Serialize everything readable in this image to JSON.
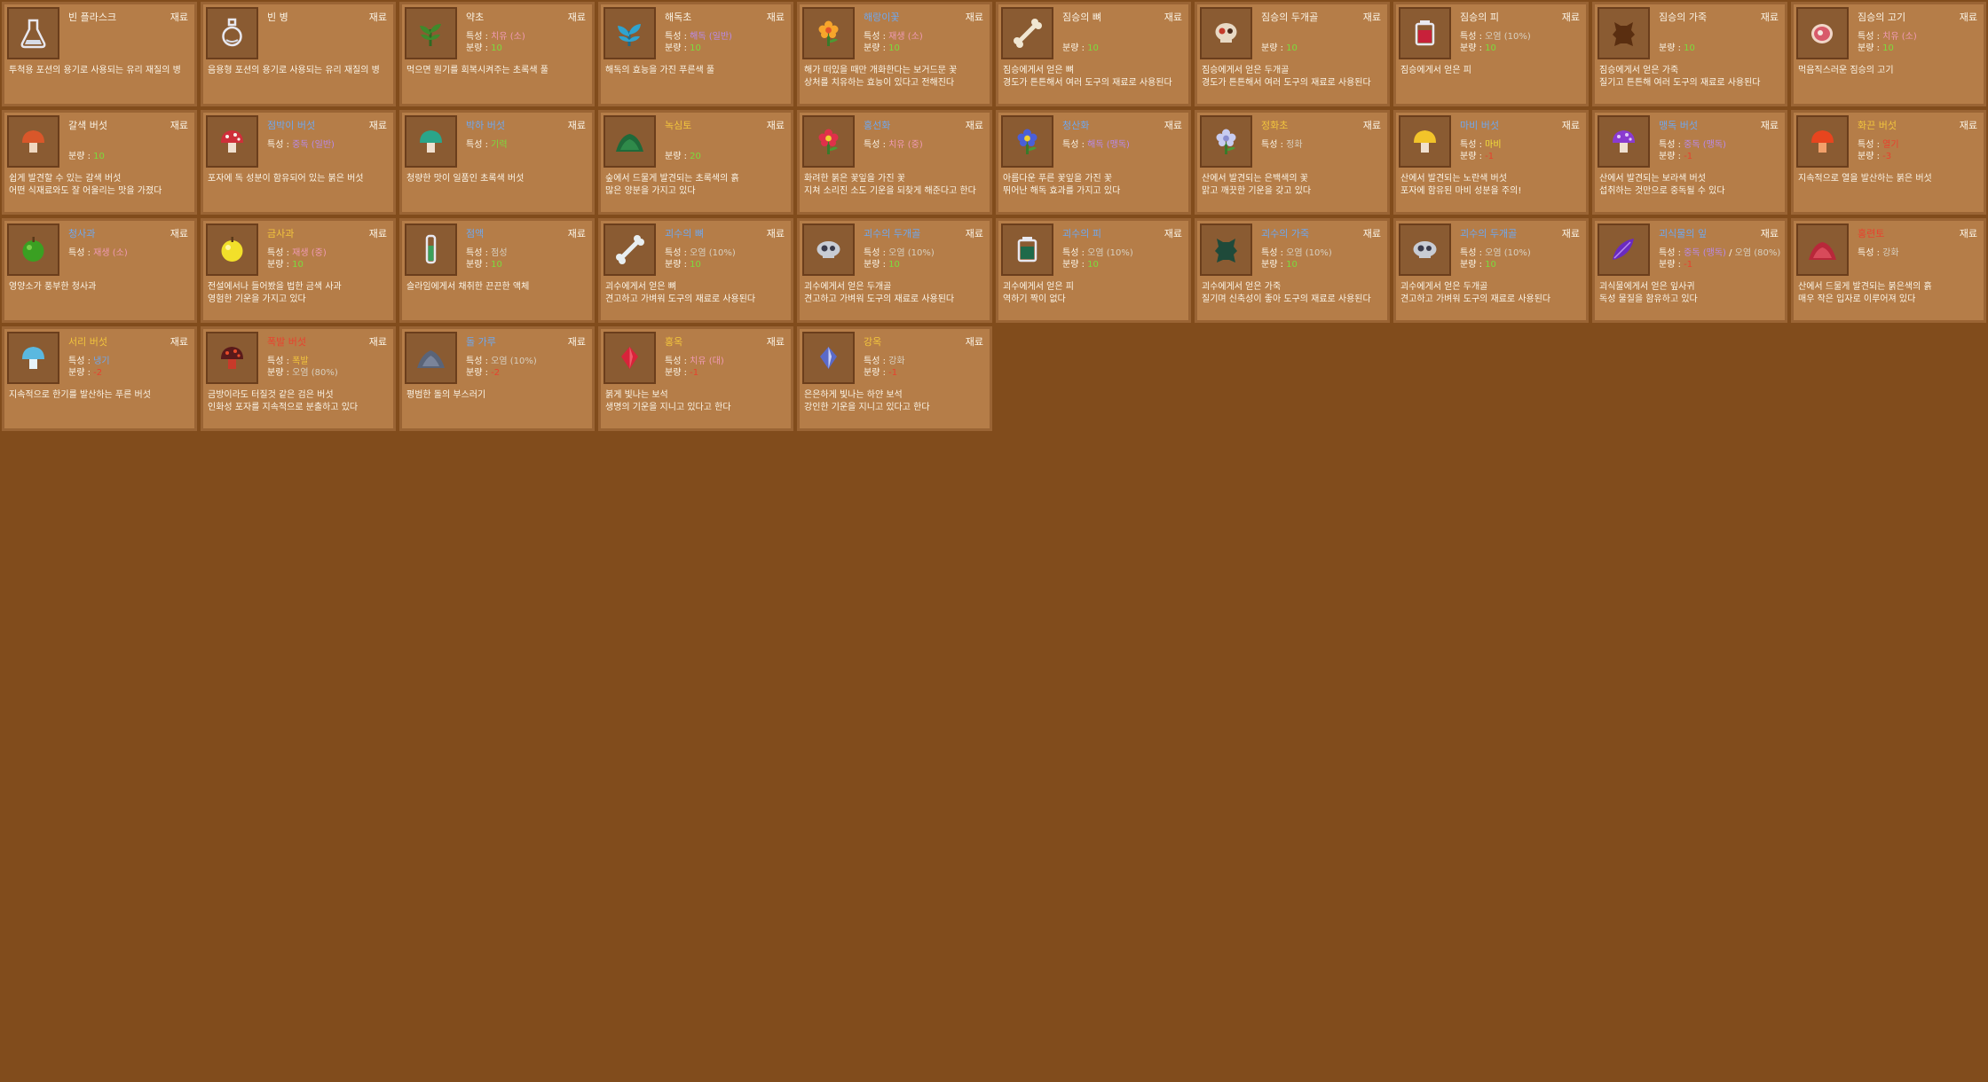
{
  "items": [
    {
      "name": "빈 플라스크",
      "name_color": "white",
      "tag": "재료",
      "icon": "flask-icon",
      "stats": [],
      "desc": "투척용 포션의 용기로 사용되는 유리 재질의 병"
    },
    {
      "name": "빈 병",
      "name_color": "white",
      "tag": "재료",
      "icon": "bottle-icon",
      "stats": [],
      "desc": "음용형 포션의 용기로 사용되는 유리 재질의 병"
    },
    {
      "name": "약초",
      "name_color": "white",
      "tag": "재료",
      "icon": "herb-icon",
      "stats": [
        {
          "label": "특성 : ",
          "parts": [
            {
              "text": "치유 (소)",
              "color": "pink"
            }
          ]
        },
        {
          "label": "분량 : ",
          "parts": [
            {
              "text": "10",
              "color": "green"
            }
          ]
        }
      ],
      "desc": "먹으면 원기를 회복시켜주는 초록색 풀"
    },
    {
      "name": "해독초",
      "name_color": "white",
      "tag": "재료",
      "icon": "antidote-herb-icon",
      "stats": [
        {
          "label": "특성 : ",
          "parts": [
            {
              "text": "해독 (일반)",
              "color": "purple"
            }
          ]
        },
        {
          "label": "분량 : ",
          "parts": [
            {
              "text": "10",
              "color": "green"
            }
          ]
        }
      ],
      "desc": "해독의 효능을 가진 푸른색 풀"
    },
    {
      "name": "해랑이꽃",
      "name_color": "blue",
      "tag": "재료",
      "icon": "orange-flower-icon",
      "stats": [
        {
          "label": "특성 : ",
          "parts": [
            {
              "text": "재생 (소)",
              "color": "pink"
            }
          ]
        },
        {
          "label": "분량 : ",
          "parts": [
            {
              "text": "10",
              "color": "green"
            }
          ]
        }
      ],
      "desc": "해가 떠있을 때만 개화한다는 보거드문 꽃\n상처를 치유하는 효능이 있다고 전해진다"
    },
    {
      "name": "짐승의 뼈",
      "name_color": "white",
      "tag": "재료",
      "icon": "bone-icon",
      "stats": [
        {
          "label": "",
          "parts": []
        },
        {
          "label": "분량 : ",
          "parts": [
            {
              "text": "10",
              "color": "green"
            }
          ]
        }
      ],
      "desc": "짐승에게서 얻은 뼈\n경도가 튼튼해서 여러 도구의 재료로 사용된다"
    },
    {
      "name": "짐승의 두개골",
      "name_color": "white",
      "tag": "재료",
      "icon": "skull-icon",
      "stats": [
        {
          "label": "",
          "parts": []
        },
        {
          "label": "분량 : ",
          "parts": [
            {
              "text": "10",
              "color": "green"
            }
          ]
        }
      ],
      "desc": "짐승에게서 얻은 두개골\n경도가 튼튼해서 여러 도구의 재료로 사용된다"
    },
    {
      "name": "짐승의 피",
      "name_color": "white",
      "tag": "재료",
      "icon": "blood-icon",
      "stats": [
        {
          "label": "특성 : ",
          "parts": [
            {
              "text": "오염 (10%)",
              "color": "gray"
            }
          ]
        },
        {
          "label": "분량 : ",
          "parts": [
            {
              "text": "10",
              "color": "green"
            }
          ]
        }
      ],
      "desc": "짐승에게서 얻은 피"
    },
    {
      "name": "짐승의 가죽",
      "name_color": "white",
      "tag": "재료",
      "icon": "leather-icon",
      "stats": [
        {
          "label": "",
          "parts": []
        },
        {
          "label": "분량 : ",
          "parts": [
            {
              "text": "10",
              "color": "green"
            }
          ]
        }
      ],
      "desc": "짐승에게서 얻은 가죽\n질기고 튼튼해 여러 도구의 재료로 사용된다"
    },
    {
      "name": "짐승의 고기",
      "name_color": "white",
      "tag": "재료",
      "icon": "meat-icon",
      "stats": [
        {
          "label": "특성 : ",
          "parts": [
            {
              "text": "치유 (소)",
              "color": "pink"
            }
          ]
        },
        {
          "label": "분량 : ",
          "parts": [
            {
              "text": "10",
              "color": "green"
            }
          ]
        }
      ],
      "desc": "먹음직스러운 짐승의 고기"
    },
    {
      "name": "갈색 버섯",
      "name_color": "white",
      "tag": "재료",
      "icon": "brown-mushroom-icon",
      "stats": [
        {
          "label": "",
          "parts": []
        },
        {
          "label": "분량 : ",
          "parts": [
            {
              "text": "10",
              "color": "green"
            }
          ]
        }
      ],
      "desc": "쉽게 발견할 수 있는 갈색 버섯\n어떤 식재료와도 잘 어울리는 맛을 가졌다"
    },
    {
      "name": "점박이 버섯",
      "name_color": "blue",
      "tag": "재료",
      "icon": "spotted-mushroom-icon",
      "stats": [
        {
          "label": "특성 : ",
          "parts": [
            {
              "text": "중독 (일반)",
              "color": "purple"
            }
          ]
        }
      ],
      "desc": "포자에 독 성분이 함유되어 있는 붉은 버섯"
    },
    {
      "name": "박하 버섯",
      "name_color": "blue",
      "tag": "재료",
      "icon": "mint-mushroom-icon",
      "stats": [
        {
          "label": "특성 : ",
          "parts": [
            {
              "text": "기력",
              "color": "green"
            }
          ]
        }
      ],
      "desc": "청량한 맛이 일품인 초록색 버섯"
    },
    {
      "name": "녹심토",
      "name_color": "orange",
      "tag": "재료",
      "icon": "green-soil-icon",
      "stats": [
        {
          "label": "",
          "parts": []
        },
        {
          "label": "분량 : ",
          "parts": [
            {
              "text": "20",
              "color": "green"
            }
          ]
        }
      ],
      "desc": "숲에서 드물게 발견되는 초록색의 흙\n많은 양분을 가지고 있다"
    },
    {
      "name": "홍선화",
      "name_color": "blue",
      "tag": "재료",
      "icon": "red-flower-icon",
      "stats": [
        {
          "label": "특성 : ",
          "parts": [
            {
              "text": "치유 (중)",
              "color": "pink"
            }
          ]
        }
      ],
      "desc": "화려한 붉은 꽃잎을 가진 꽃\n지쳐 소리진 소도 기운을 되찾게 해준다고 한다"
    },
    {
      "name": "청산화",
      "name_color": "blue",
      "tag": "재료",
      "icon": "blue-flower-icon",
      "stats": [
        {
          "label": "특성 : ",
          "parts": [
            {
              "text": "해독 (맹독)",
              "color": "purple"
            }
          ]
        }
      ],
      "desc": "아름다운 푸른 꽃잎을 가진 꽃\n뛰어난 해독 효과를 가지고 있다"
    },
    {
      "name": "정화초",
      "name_color": "orange",
      "tag": "재료",
      "icon": "silver-flower-icon",
      "stats": [
        {
          "label": "특성 : ",
          "parts": [
            {
              "text": "정화",
              "color": "gray"
            }
          ]
        }
      ],
      "desc": "산에서 발견되는 은백색의 꽃\n맑고 깨끗한 기운을 갖고 있다"
    },
    {
      "name": "마비 버섯",
      "name_color": "blue",
      "tag": "재료",
      "icon": "yellow-mushroom-icon",
      "stats": [
        {
          "label": "특성 : ",
          "parts": [
            {
              "text": "마비",
              "color": "yellow"
            }
          ]
        },
        {
          "label": "분량 : ",
          "parts": [
            {
              "text": "-1",
              "color": "red"
            }
          ]
        }
      ],
      "desc": "산에서 발견되는 노란색 버섯\n포자에 함유된 마비 성분을 주의!"
    },
    {
      "name": "맹독 버섯",
      "name_color": "blue",
      "tag": "재료",
      "icon": "purple-mushroom-icon",
      "stats": [
        {
          "label": "특성 : ",
          "parts": [
            {
              "text": "중독 (맹독)",
              "color": "purple"
            }
          ]
        },
        {
          "label": "분량 : ",
          "parts": [
            {
              "text": "-1",
              "color": "red"
            }
          ]
        }
      ],
      "desc": "산에서 발견되는 보라색 버섯\n섭취하는 것만으로 중독될 수 있다"
    },
    {
      "name": "화끈 버섯",
      "name_color": "orange",
      "tag": "재료",
      "icon": "fire-mushroom-icon",
      "stats": [
        {
          "label": "특성 : ",
          "parts": [
            {
              "text": "열기",
              "color": "red"
            }
          ]
        },
        {
          "label": "분량 : ",
          "parts": [
            {
              "text": "-3",
              "color": "red"
            }
          ]
        }
      ],
      "desc": "지속적으로 열을 발산하는 붉은 버섯"
    },
    {
      "name": "청사과",
      "name_color": "blue",
      "tag": "재료",
      "icon": "green-apple-icon",
      "stats": [
        {
          "label": "특성 : ",
          "parts": [
            {
              "text": "재생 (소)",
              "color": "pink"
            }
          ]
        }
      ],
      "desc": "영양소가 풍부한 청사과"
    },
    {
      "name": "금사과",
      "name_color": "orange",
      "tag": "재료",
      "icon": "golden-apple-icon",
      "stats": [
        {
          "label": "특성 : ",
          "parts": [
            {
              "text": "재생 (중)",
              "color": "pink"
            }
          ]
        },
        {
          "label": "분량 : ",
          "parts": [
            {
              "text": "10",
              "color": "green"
            }
          ]
        }
      ],
      "desc": "전설에서나 들어봤을 법한 금색 사과\n영험한 기운을 가지고 있다"
    },
    {
      "name": "점액",
      "name_color": "blue",
      "tag": "재료",
      "icon": "slime-icon",
      "stats": [
        {
          "label": "특성 : ",
          "parts": [
            {
              "text": "점성",
              "color": "gray"
            }
          ]
        },
        {
          "label": "분량 : ",
          "parts": [
            {
              "text": "10",
              "color": "green"
            }
          ]
        }
      ],
      "desc": "슬라임에게서 채취한 끈끈한 액체"
    },
    {
      "name": "괴수의 뼈",
      "name_color": "blue",
      "tag": "재료",
      "icon": "monster-bone-icon",
      "stats": [
        {
          "label": "특성 : ",
          "parts": [
            {
              "text": "오염 (10%)",
              "color": "gray"
            }
          ]
        },
        {
          "label": "분량 : ",
          "parts": [
            {
              "text": "10",
              "color": "green"
            }
          ]
        }
      ],
      "desc": "괴수에게서 얻은 뼈\n견고하고 가벼워 도구의 재료로 사용된다"
    },
    {
      "name": "괴수의 두개골",
      "name_color": "blue",
      "tag": "재료",
      "icon": "monster-skull-icon",
      "stats": [
        {
          "label": "특성 : ",
          "parts": [
            {
              "text": "오염 (10%)",
              "color": "gray"
            }
          ]
        },
        {
          "label": "분량 : ",
          "parts": [
            {
              "text": "10",
              "color": "green"
            }
          ]
        }
      ],
      "desc": "괴수에게서 얻은 두개골\n견고하고 가벼워 도구의 재료로 사용된다"
    },
    {
      "name": "괴수의 피",
      "name_color": "blue",
      "tag": "재료",
      "icon": "monster-blood-icon",
      "stats": [
        {
          "label": "특성 : ",
          "parts": [
            {
              "text": "오염 (10%)",
              "color": "gray"
            }
          ]
        },
        {
          "label": "분량 : ",
          "parts": [
            {
              "text": "10",
              "color": "green"
            }
          ]
        }
      ],
      "desc": "괴수에게서 얻은 피\n역하기 짝이 없다"
    },
    {
      "name": "괴수의 가죽",
      "name_color": "blue",
      "tag": "재료",
      "icon": "monster-leather-icon",
      "stats": [
        {
          "label": "특성 : ",
          "parts": [
            {
              "text": "오염 (10%)",
              "color": "gray"
            }
          ]
        },
        {
          "label": "분량 : ",
          "parts": [
            {
              "text": "10",
              "color": "green"
            }
          ]
        }
      ],
      "desc": "괴수에게서 얻은 가죽\n질기며 신축성이 좋아 도구의 재료로 사용된다"
    },
    {
      "name": "괴수의 두개골",
      "name_color": "blue",
      "tag": "재료",
      "icon": "monster-skull-icon",
      "stats": [
        {
          "label": "특성 : ",
          "parts": [
            {
              "text": "오염 (10%)",
              "color": "gray"
            }
          ]
        },
        {
          "label": "분량 : ",
          "parts": [
            {
              "text": "10",
              "color": "green"
            }
          ]
        }
      ],
      "desc": "괴수에게서 얻은 두개골\n견고하고 가벼워 도구의 재료로 사용된다"
    },
    {
      "name": "괴식물의 잎",
      "name_color": "blue",
      "tag": "재료",
      "icon": "monster-leaf-icon",
      "stats": [
        {
          "label": "특성 : ",
          "parts": [
            {
              "text": "중독 (맹독)",
              "color": "purple"
            },
            {
              "text": " / ",
              "color": "white"
            },
            {
              "text": "오염 (80%)",
              "color": "gray"
            }
          ]
        },
        {
          "label": "분량 : ",
          "parts": [
            {
              "text": "-1",
              "color": "red"
            }
          ]
        }
      ],
      "desc": "괴식물에게서 얻은 잎사귀\n독성 물질을 함유하고 있다"
    },
    {
      "name": "홍련토",
      "name_color": "red",
      "tag": "재료",
      "icon": "red-soil-icon",
      "stats": [
        {
          "label": "특성 : ",
          "parts": [
            {
              "text": "강화",
              "color": "gray"
            }
          ]
        }
      ],
      "desc": "산에서 드물게 발견되는 붉은색의 흙\n매우 작은 입자로 이루어져 있다"
    },
    {
      "name": "서리 버섯",
      "name_color": "orange",
      "tag": "재료",
      "icon": "frost-mushroom-icon",
      "stats": [
        {
          "label": "특성 : ",
          "parts": [
            {
              "text": "냉기",
              "color": "blue"
            }
          ]
        },
        {
          "label": "분량 : ",
          "parts": [
            {
              "text": "-2",
              "color": "red"
            }
          ]
        }
      ],
      "desc": "지속적으로 한기를 발산하는 푸른 버섯"
    },
    {
      "name": "폭발 버섯",
      "name_color": "red",
      "tag": "재료",
      "icon": "explosive-mushroom-icon",
      "stats": [
        {
          "label": "특성 : ",
          "parts": [
            {
              "text": "폭발",
              "color": "orange"
            }
          ]
        },
        {
          "label": "분량 : ",
          "parts": [
            {
              "text": "오염 (80%)",
              "color": "gray"
            }
          ]
        }
      ],
      "desc": "금방이라도 터질것 같은 검은 버섯\n인화성 포자를 지속적으로 분출하고 있다"
    },
    {
      "name": "돌 가루",
      "name_color": "blue",
      "tag": "재료",
      "icon": "stone-dust-icon",
      "stats": [
        {
          "label": "특성 : ",
          "parts": [
            {
              "text": "오염 (10%)",
              "color": "gray"
            }
          ]
        },
        {
          "label": "분량 : ",
          "parts": [
            {
              "text": "-2",
              "color": "red"
            }
          ]
        }
      ],
      "desc": "평범한 돌의 부스러기"
    },
    {
      "name": "홍옥",
      "name_color": "orange",
      "tag": "재료",
      "icon": "ruby-icon",
      "stats": [
        {
          "label": "특성 : ",
          "parts": [
            {
              "text": "치유 (대)",
              "color": "pink"
            }
          ]
        },
        {
          "label": "분량 : ",
          "parts": [
            {
              "text": "-1",
              "color": "red"
            }
          ]
        }
      ],
      "desc": "붉게 빛나는 보석\n생명의 기운을 지니고 있다고 한다"
    },
    {
      "name": "강옥",
      "name_color": "orange",
      "tag": "재료",
      "icon": "diamond-icon",
      "stats": [
        {
          "label": "특성 : ",
          "parts": [
            {
              "text": "강화",
              "color": "gray"
            }
          ]
        },
        {
          "label": "분량 : ",
          "parts": [
            {
              "text": "-1",
              "color": "red"
            }
          ]
        }
      ],
      "desc": "은은하게 빛나는 하얀 보석\n강인한 기운을 지니고 있다고 한다"
    }
  ]
}
